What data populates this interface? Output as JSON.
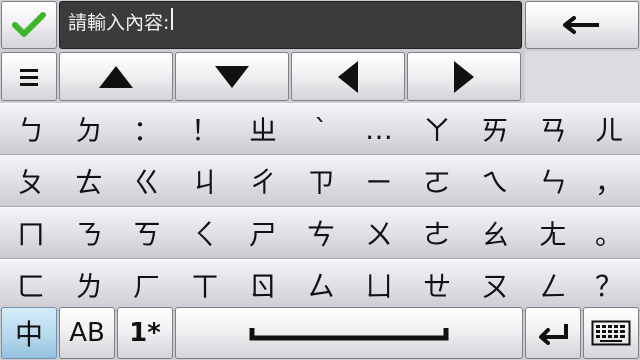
{
  "top_bar": {
    "input_prompt": "請輸入內容:",
    "confirm_icon": "check-icon",
    "backspace_icon": "arrow-left-icon",
    "colors": {
      "check": "#3fb52a",
      "input_bg": "#3b3b3b",
      "input_text": "#f2f2f2"
    }
  },
  "nav_row": {
    "menu_icon": "menu-icon",
    "arrows": [
      "up-arrow-icon",
      "down-arrow-icon",
      "left-arrow-icon",
      "right-arrow-icon"
    ]
  },
  "keyboard": {
    "rows": [
      [
        "ㄅ",
        "ㄉ",
        "：",
        "！",
        "ㄓ",
        "ˋ",
        "…",
        "ㄚ",
        "ㄞ",
        "ㄢ",
        "ㄦ"
      ],
      [
        "ㄆ",
        "ㄊ",
        "ㄍ",
        "ㄐ",
        "ㄔ",
        "ㄗ",
        "ㄧ",
        "ㄛ",
        "ㄟ",
        "ㄣ",
        "，"
      ],
      [
        "ㄇ",
        "ㄋ",
        "ㄎ",
        "ㄑ",
        "ㄕ",
        "ㄘ",
        "ㄨ",
        "ㄜ",
        "ㄠ",
        "ㄤ",
        "。"
      ],
      [
        "ㄈ",
        "ㄌ",
        "ㄏ",
        "ㄒ",
        "ㄖ",
        "ㄙ",
        "ㄩ",
        "ㄝ",
        "ㄡ",
        "ㄥ",
        "？"
      ]
    ]
  },
  "bottom_bar": {
    "mode_chinese": "中",
    "mode_alpha": "AB",
    "mode_numeric": "1*",
    "space_icon": "space-bar-icon",
    "enter_icon": "enter-icon",
    "keyboard_icon": "keyboard-icon"
  }
}
